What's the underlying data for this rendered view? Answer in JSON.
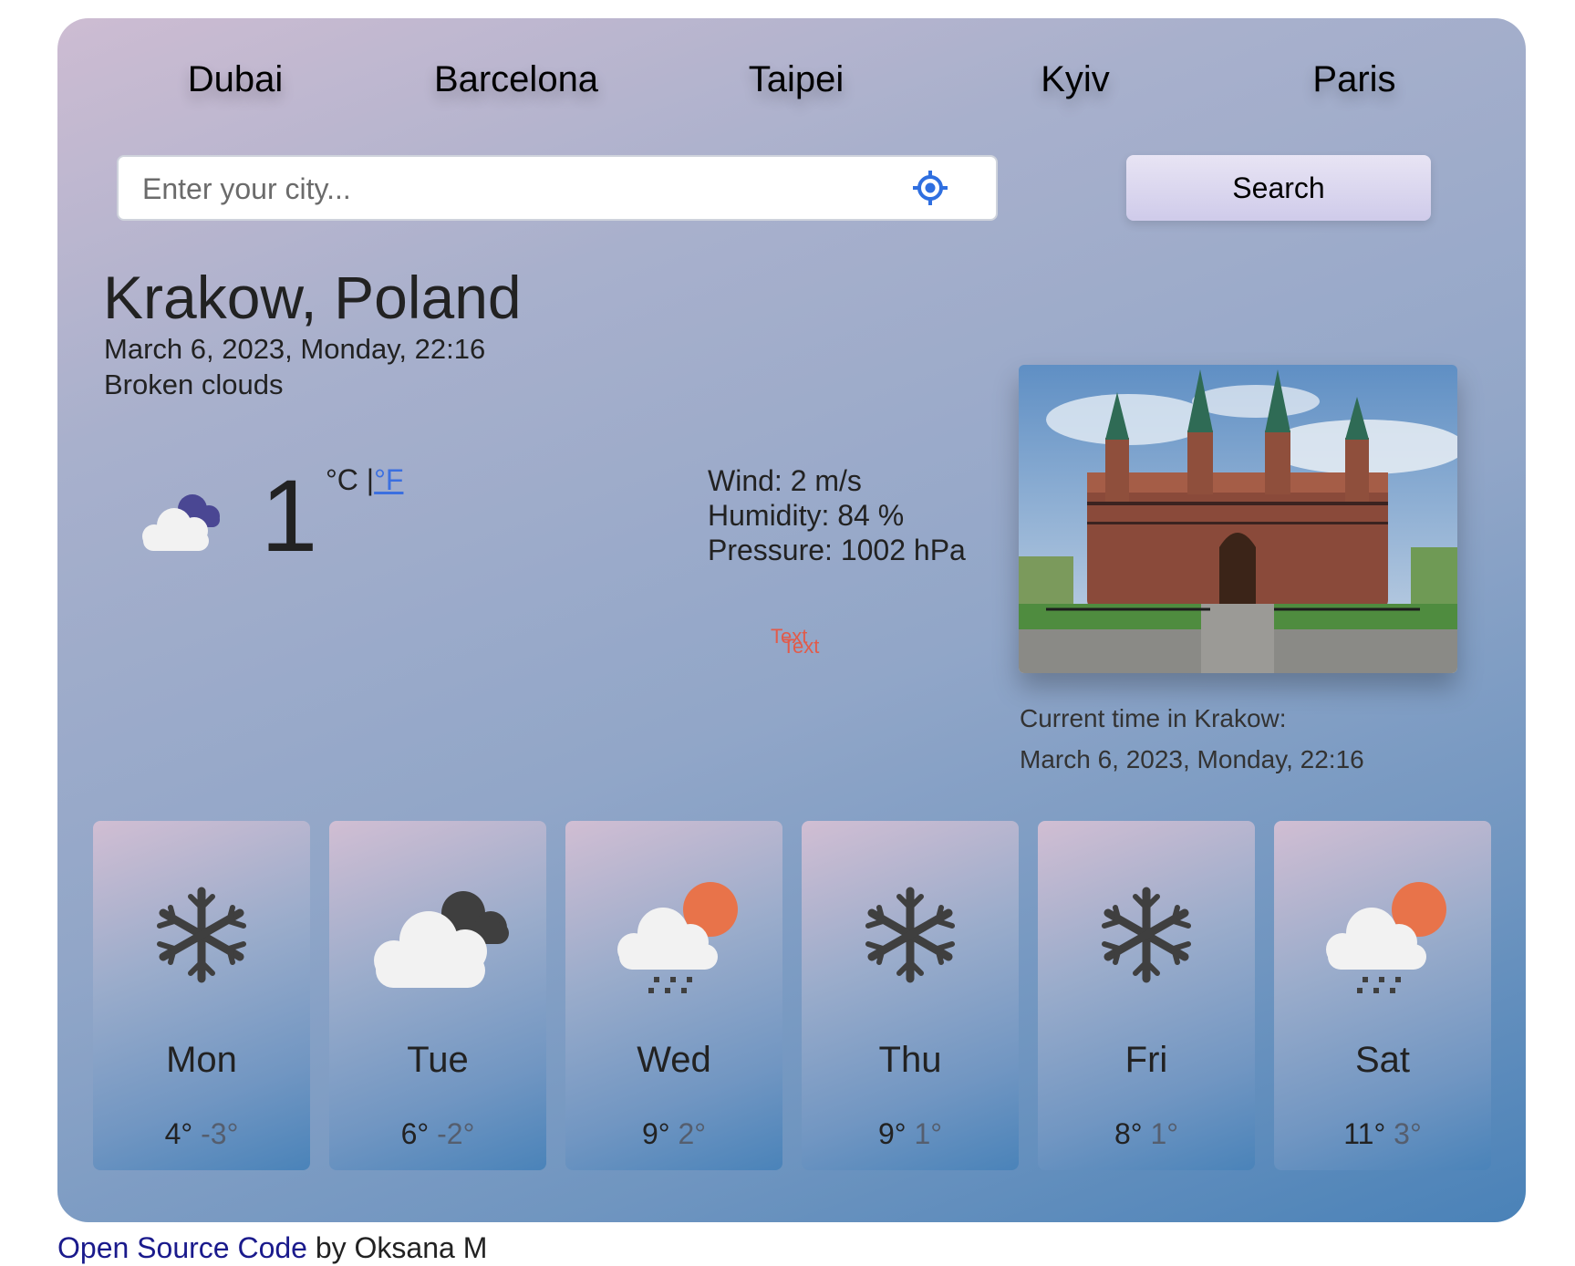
{
  "cities": [
    "Dubai",
    "Barcelona",
    "Taipei",
    "Kyiv",
    "Paris"
  ],
  "search": {
    "placeholder": "Enter your city...",
    "value": "",
    "button_label": "Search"
  },
  "current": {
    "city": "Krakow, Poland",
    "date": "March 6, 2023, Monday, 22:16",
    "description": "Broken clouds",
    "icon": "broken-clouds-icon",
    "temperature": "1",
    "unit_c": "°C |",
    "unit_f": "°F",
    "wind": "Wind: 2 m/s",
    "humidity": "Humidity: 84 %",
    "pressure": "Pressure: 1002 hPa",
    "placeholder_texts": [
      "Text",
      "Text"
    ]
  },
  "photo": {
    "alt": "Krakow Barbican",
    "time_label": "Current time in Krakow:",
    "time_value": "March 6, 2023, Monday, 22:16"
  },
  "forecast": [
    {
      "day": "Mon",
      "max": "4°",
      "min": "-3°",
      "icon": "snow-icon"
    },
    {
      "day": "Tue",
      "max": "6°",
      "min": "-2°",
      "icon": "broken-clouds-icon"
    },
    {
      "day": "Wed",
      "max": "9°",
      "min": "2°",
      "icon": "rain-sun-icon"
    },
    {
      "day": "Thu",
      "max": "9°",
      "min": "1°",
      "icon": "snow-icon"
    },
    {
      "day": "Fri",
      "max": "8°",
      "min": "1°",
      "icon": "snow-icon"
    },
    {
      "day": "Sat",
      "max": "11°",
      "min": "3°",
      "icon": "rain-sun-icon"
    }
  ],
  "footer": {
    "link": "Open Source Code",
    "suffix": " by Oksana M"
  },
  "colors": {
    "accent": "#3b6fe0",
    "sun": "#e8734a",
    "link": "#1a1a8c"
  }
}
